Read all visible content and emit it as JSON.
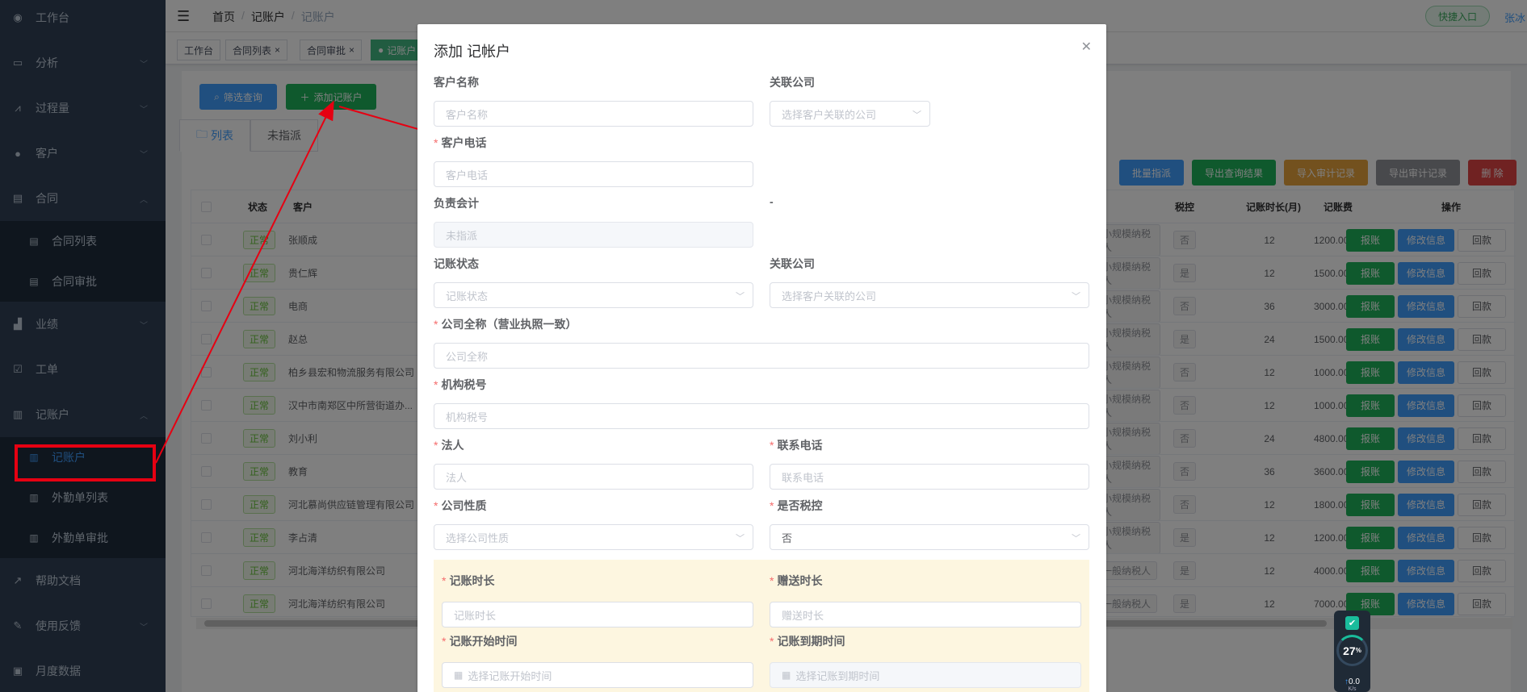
{
  "sidebar": {
    "items": [
      {
        "label": "工作台",
        "icon": "dashboard-icon"
      },
      {
        "label": "分析",
        "icon": "monitor-icon"
      },
      {
        "label": "过程量",
        "icon": "chart-icon"
      },
      {
        "label": "客户",
        "icon": "user-icon"
      },
      {
        "label": "合同",
        "icon": "document-icon"
      },
      {
        "label": "业绩",
        "icon": "bar-chart-icon"
      },
      {
        "label": "工单",
        "icon": "clipboard-icon"
      },
      {
        "label": "记账户",
        "icon": "ledger-icon"
      },
      {
        "label": "帮助文档",
        "icon": "external-link-icon"
      },
      {
        "label": "使用反馈",
        "icon": "feedback-icon"
      },
      {
        "label": "月度数据",
        "icon": "data-icon"
      }
    ],
    "contract_sub": [
      "合同列表",
      "合同审批"
    ],
    "ledger_sub": [
      "记账户",
      "外勤单列表",
      "外勤单审批"
    ]
  },
  "navbar": {
    "breadcrumb": [
      "首页",
      "记账户",
      "记账户"
    ],
    "quick_entry": "快捷入口",
    "user": "张冰"
  },
  "tags": [
    "工作台",
    "合同列表",
    "合同审批",
    "记账户"
  ],
  "toolbar": {
    "filter": "筛选查询",
    "add": "添加记账户",
    "batch_assign": "批量指派",
    "export_query": "导出查询结果",
    "import_audit": "导入审计记录",
    "export_audit": "导出审计记录",
    "delete": "删 除"
  },
  "tabs": [
    "列表",
    "未指派"
  ],
  "table": {
    "headers": {
      "status": "状态",
      "customer": "客户",
      "tax": "税控",
      "duration": "记账时长(月)",
      "fee": "记账费",
      "ops": "操作"
    },
    "rows": [
      {
        "status": "正常",
        "customer": "张顺成",
        "taxpayer": "小规模纳税人",
        "tax": "否",
        "duration": "12",
        "fee": "1200.00"
      },
      {
        "status": "正常",
        "customer": "贵仁辉",
        "taxpayer": "小规模纳税人",
        "tax": "是",
        "duration": "12",
        "fee": "1500.00"
      },
      {
        "status": "正常",
        "customer": "电商",
        "taxpayer": "小规模纳税人",
        "tax": "否",
        "duration": "36",
        "fee": "3000.00"
      },
      {
        "status": "正常",
        "customer": "赵总",
        "taxpayer": "小规模纳税人",
        "tax": "是",
        "duration": "24",
        "fee": "1500.00"
      },
      {
        "status": "正常",
        "customer": "柏乡县宏和物流服务有限公司",
        "taxpayer": "小规模纳税人",
        "tax": "否",
        "duration": "12",
        "fee": "1000.00"
      },
      {
        "status": "正常",
        "customer": "汉中市南郑区中所营街道办...",
        "taxpayer": "小规模纳税人",
        "tax": "否",
        "duration": "12",
        "fee": "1000.00"
      },
      {
        "status": "正常",
        "customer": "刘小利",
        "taxpayer": "小规模纳税人",
        "tax": "否",
        "duration": "24",
        "fee": "4800.00"
      },
      {
        "status": "正常",
        "customer": "教育",
        "taxpayer": "小规模纳税人",
        "tax": "否",
        "duration": "36",
        "fee": "3600.00"
      },
      {
        "status": "正常",
        "customer": "河北慕尚供应链管理有限公司",
        "taxpayer": "小规模纳税人",
        "tax": "否",
        "duration": "12",
        "fee": "1800.00"
      },
      {
        "status": "正常",
        "customer": "李占清",
        "taxpayer": "小规模纳税人",
        "tax": "是",
        "duration": "12",
        "fee": "1200.00"
      },
      {
        "status": "正常",
        "customer": "河北海洋纺织有限公司",
        "taxpayer": "一般纳税人",
        "tax": "是",
        "duration": "12",
        "fee": "4000.00"
      },
      {
        "status": "正常",
        "customer": "河北海洋纺织有限公司",
        "taxpayer": "一般纳税人",
        "tax": "是",
        "duration": "12",
        "fee": "7000.00"
      }
    ],
    "op_labels": {
      "report": "报账",
      "edit": "修改信息",
      "payment": "回款"
    }
  },
  "dialog": {
    "title": "添加 记帐户",
    "fields": {
      "customer_name": {
        "label": "客户名称",
        "placeholder": "客户名称"
      },
      "related_company_1": {
        "label": "关联公司",
        "placeholder": "选择客户关联的公司"
      },
      "customer_phone": {
        "label": "客户电话",
        "placeholder": "客户电话"
      },
      "accountant": {
        "label": "负责会计",
        "placeholder": "未指派"
      },
      "dash": "-",
      "bookkeeping_status": {
        "label": "记账状态",
        "placeholder": "记账状态"
      },
      "related_company_2": {
        "label": "关联公司",
        "placeholder": "选择客户关联的公司"
      },
      "company_full_name": {
        "label": "公司全称（营业执照一致）",
        "placeholder": "公司全称"
      },
      "tax_number": {
        "label": "机构税号",
        "placeholder": "机构税号"
      },
      "legal_person": {
        "label": "法人",
        "placeholder": "法人"
      },
      "contact_phone": {
        "label": "联系电话",
        "placeholder": "联系电话"
      },
      "company_nature": {
        "label": "公司性质",
        "placeholder": "选择公司性质"
      },
      "tax_control": {
        "label": "是否税控",
        "value": "否"
      },
      "duration": {
        "label": "记账时长",
        "placeholder": "记账时长"
      },
      "gift_duration": {
        "label": "赠送时长",
        "placeholder": "赠送时长"
      },
      "start_time": {
        "label": "记账开始时间",
        "placeholder": "选择记账开始时间"
      },
      "end_time": {
        "label": "记账到期时间",
        "placeholder": "选择记账到期时间"
      }
    }
  },
  "widget": {
    "percent": "27",
    "unit": "%",
    "speed": "0.0",
    "speed_unit": "K/s"
  },
  "colors": {
    "sidebar": "#304156",
    "primary": "#409eff",
    "success": "#1fb35a",
    "warning": "#e6a23c",
    "danger": "#e04545",
    "annotation": "#e60012"
  }
}
